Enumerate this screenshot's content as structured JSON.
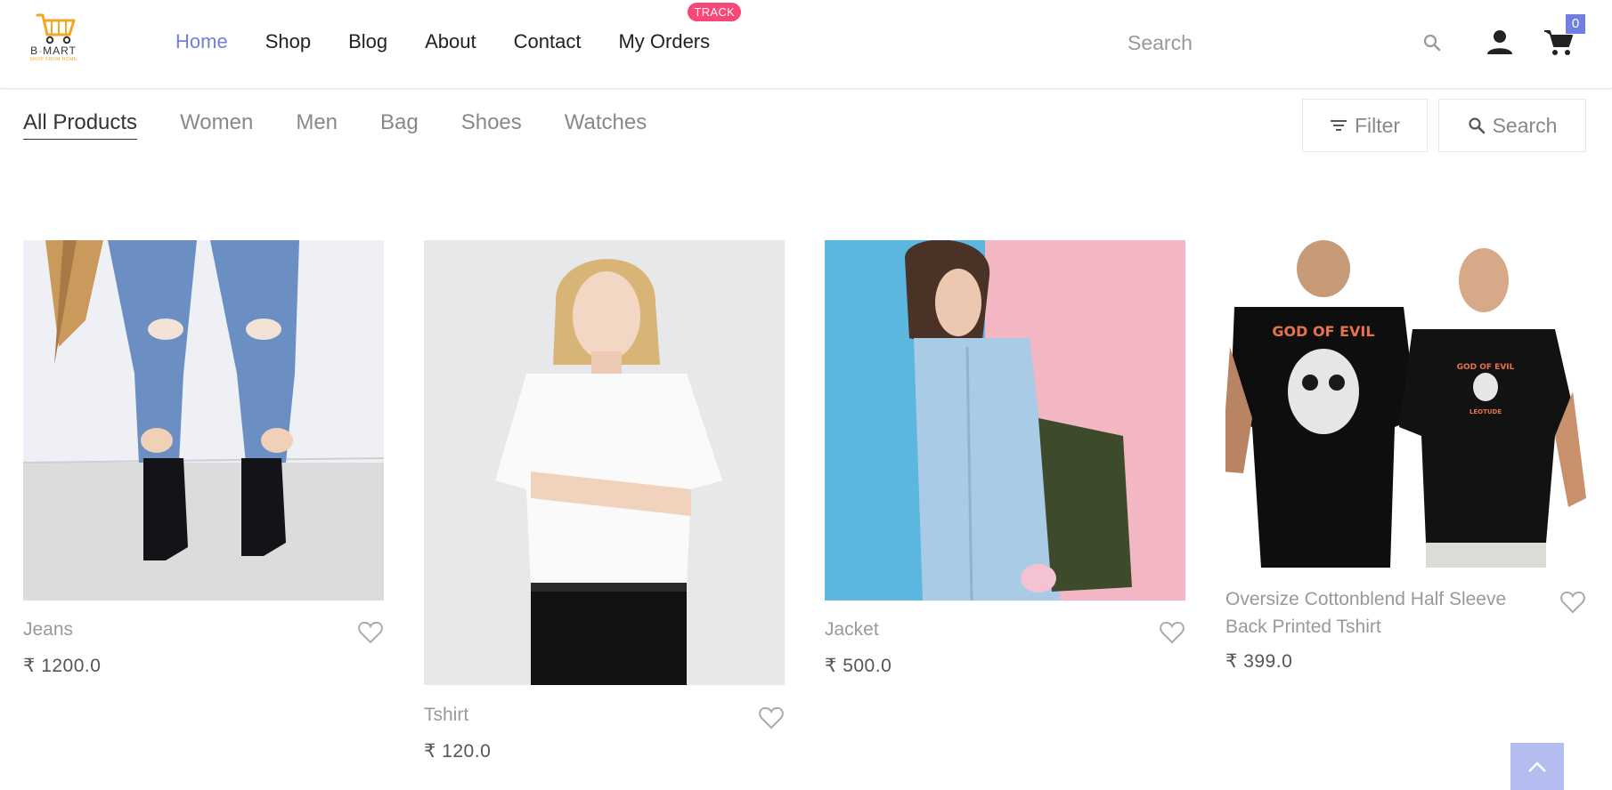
{
  "header": {
    "logo_text_prefix": "B",
    "logo_text_accent": "-",
    "logo_text_suffix": "MART",
    "logo_tagline": "SHOP FROM HOME",
    "nav": [
      {
        "label": "Home",
        "active": true
      },
      {
        "label": "Shop",
        "active": false
      },
      {
        "label": "Blog",
        "active": false
      },
      {
        "label": "About",
        "active": false
      },
      {
        "label": "Contact",
        "active": false
      },
      {
        "label": "My Orders",
        "active": false
      }
    ],
    "track_badge": "TRACK",
    "search_placeholder": "Search",
    "cart_count": "0"
  },
  "categories": [
    {
      "label": "All Products",
      "active": true
    },
    {
      "label": "Women",
      "active": false
    },
    {
      "label": "Men",
      "active": false
    },
    {
      "label": "Bag",
      "active": false
    },
    {
      "label": "Shoes",
      "active": false
    },
    {
      "label": "Watches",
      "active": false
    }
  ],
  "tools": {
    "filter_label": "Filter",
    "search_label": "Search"
  },
  "products": [
    {
      "name": "Jeans",
      "price": "₹ 1200.0"
    },
    {
      "name": "Tshirt",
      "price": "₹ 120.0"
    },
    {
      "name": "Jacket",
      "price": "₹ 500.0"
    },
    {
      "name": "Oversize Cottonblend Half Sleeve Back Printed Tshirt",
      "price": "₹ 399.0",
      "print_text": "GOD OF EVIL",
      "print_text_small": "LEOTUDE"
    }
  ],
  "colors": {
    "accent": "#717fe0",
    "badge": "#f74877",
    "logo_orange": "#f5a623"
  },
  "icons": [
    "cart-logo-icon",
    "search-icon",
    "user-icon",
    "cart-icon",
    "filter-icon",
    "heart-icon",
    "chevron-up-icon"
  ]
}
